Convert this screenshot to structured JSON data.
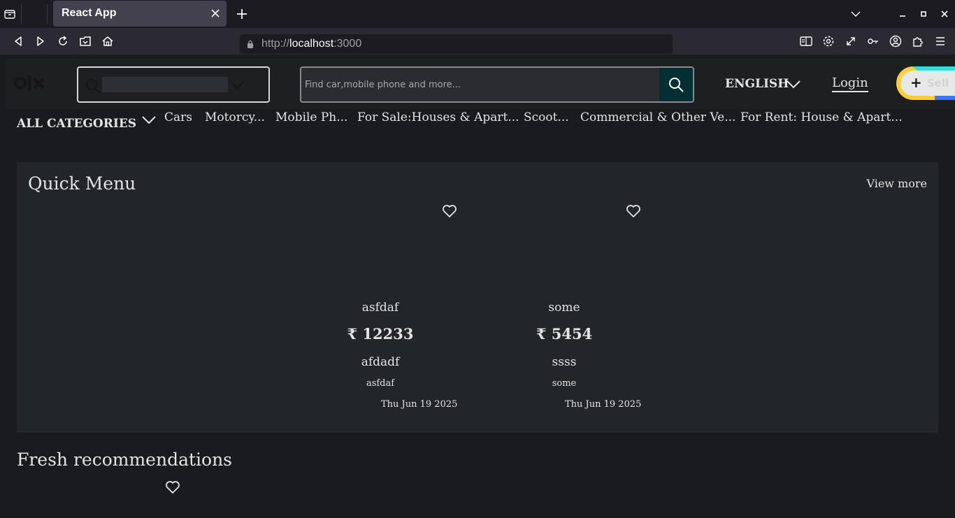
{
  "browser": {
    "tab_title": "React App",
    "url_scheme": "http://",
    "url_host": "localhost",
    "url_port": ":3000"
  },
  "header": {
    "logo": "olx",
    "search_placeholder": "Find car,mobile phone and more...",
    "language": "ENGLISH",
    "login": "Login",
    "sell_label": "Sell",
    "sell_plus": "+"
  },
  "categories": {
    "all_label": "ALL CATEGORIES",
    "items": [
      "Cars",
      "Motorcy...",
      "Mobile Ph...",
      "For Sale:Houses & Apart...",
      "Scoot...",
      "Commercial & Other Ve...",
      "For Rent: House & Apart..."
    ]
  },
  "quick_menu": {
    "title": "Quick Menu",
    "view_more": "View more",
    "cards": [
      {
        "title": "asfdaf",
        "price": "₹ 12233",
        "subtitle": "afdadf",
        "category": "asfdaf",
        "date": "Thu Jun 19 2025"
      },
      {
        "title": "some",
        "price": "₹ 5454",
        "subtitle": "ssss",
        "category": "some",
        "date": "Thu Jun 19 2025"
      }
    ]
  },
  "fresh": {
    "title": "Fresh recommendations"
  },
  "icons": {
    "heart": "heart-outline-icon",
    "search": "search-icon",
    "chevron": "chevron-down-icon"
  }
}
